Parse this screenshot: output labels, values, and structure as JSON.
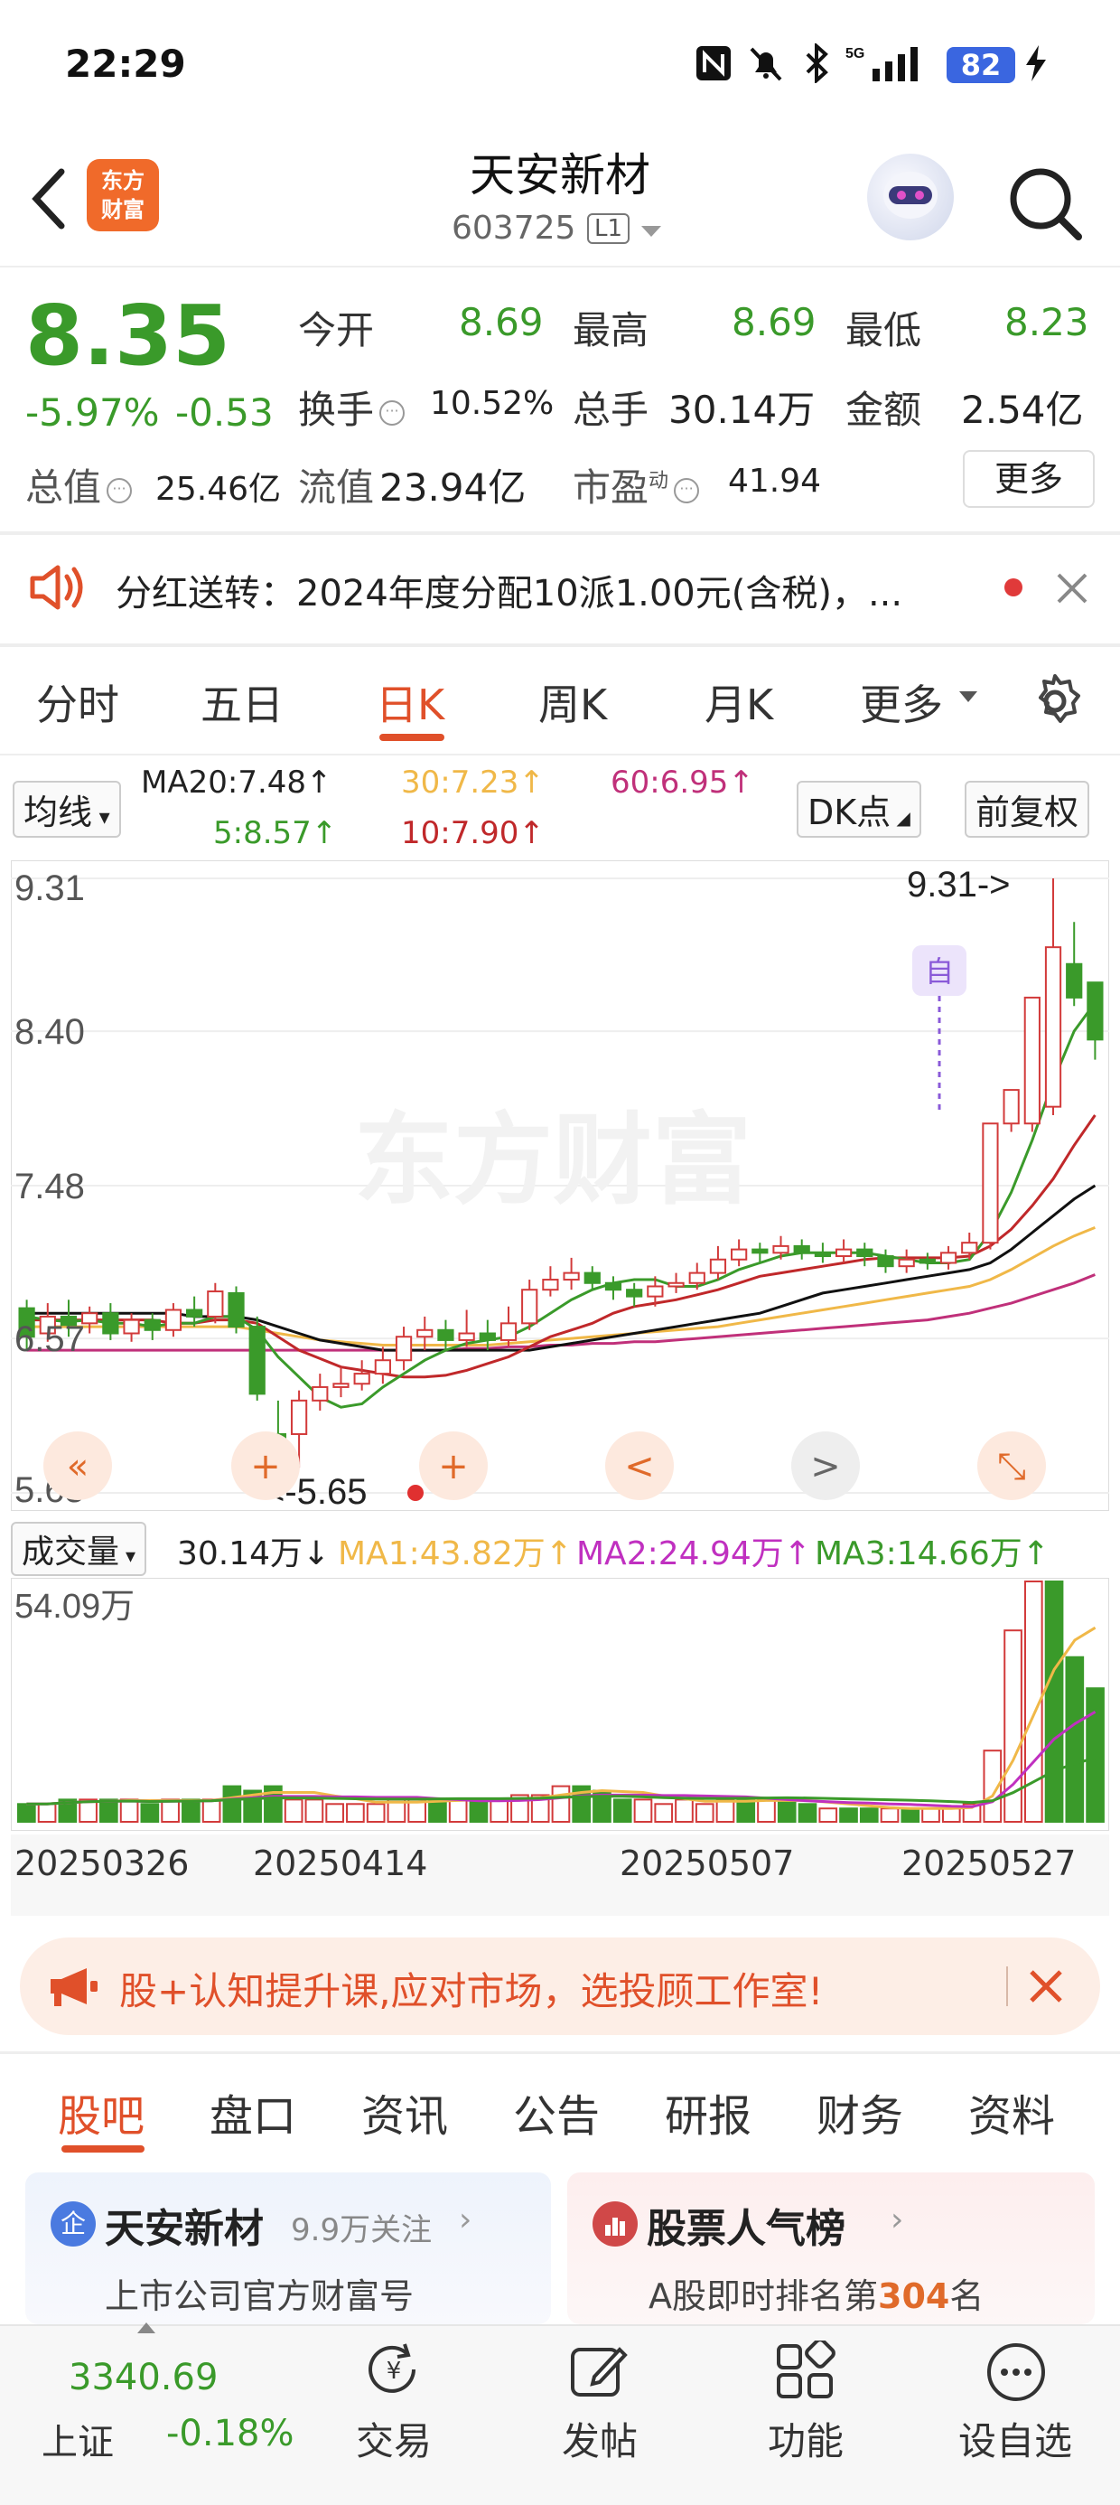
{
  "status_bar": {
    "time": "22:29",
    "battery": "82"
  },
  "header": {
    "logo_text_1": "东方",
    "logo_text_2": "财富",
    "stock_name": "天安新材",
    "stock_code": "603725",
    "level": "L1"
  },
  "quote": {
    "price": "8.35",
    "change_pct": "-5.97%",
    "change": "-0.53",
    "open_label": "今开",
    "open": "8.69",
    "high_label": "最高",
    "high": "8.69",
    "low_label": "最低",
    "low": "8.23",
    "turnover_label": "换手",
    "turnover": "10.52%",
    "volume_label": "总手",
    "volume": "30.14万",
    "amount_label": "金额",
    "amount": "2.54亿",
    "mktcap_label": "总值",
    "mktcap": "25.46亿",
    "float_label": "流值",
    "float_cap": "23.94亿",
    "pe_label": "市盈",
    "pe_sup": "动",
    "pe": "41.94",
    "more_label": "更多"
  },
  "notice": {
    "text": "分红送转：2024年度分配10派1.00元(含税)，..."
  },
  "kline_tabs": [
    "分时",
    "五日",
    "日K",
    "周K",
    "月K",
    "更多"
  ],
  "ma_row": {
    "selector": "均线",
    "ma20": "MA20:7.48↑",
    "ma30": "30:7.23↑",
    "ma60": "60:6.95↑",
    "ma5": "5:8.57↑",
    "ma10": "10:7.90↑",
    "dk_label": "DK点",
    "adj_label": "前复权"
  },
  "chart_data": {
    "type": "candlestick",
    "y_ticks": [
      "9.31",
      "8.40",
      "7.48",
      "6.57",
      "5.65"
    ],
    "ylim": [
      5.65,
      9.31
    ],
    "high_marker": "9.31->",
    "low_marker": "<-5.65",
    "self_marker": "自",
    "watermark": "东方财富",
    "candles": [
      {
        "o": 6.75,
        "c": 6.58,
        "h": 6.8,
        "l": 6.5
      },
      {
        "o": 6.6,
        "c": 6.7,
        "h": 6.78,
        "l": 6.55
      },
      {
        "o": 6.7,
        "c": 6.65,
        "h": 6.8,
        "l": 6.58
      },
      {
        "o": 6.66,
        "c": 6.72,
        "h": 6.76,
        "l": 6.6
      },
      {
        "o": 6.72,
        "c": 6.6,
        "h": 6.78,
        "l": 6.56
      },
      {
        "o": 6.6,
        "c": 6.68,
        "h": 6.72,
        "l": 6.55
      },
      {
        "o": 6.68,
        "c": 6.62,
        "h": 6.72,
        "l": 6.56
      },
      {
        "o": 6.62,
        "c": 6.74,
        "h": 6.78,
        "l": 6.58
      },
      {
        "o": 6.74,
        "c": 6.7,
        "h": 6.82,
        "l": 6.64
      },
      {
        "o": 6.7,
        "c": 6.85,
        "h": 6.9,
        "l": 6.66
      },
      {
        "o": 6.84,
        "c": 6.64,
        "h": 6.88,
        "l": 6.6
      },
      {
        "o": 6.64,
        "c": 6.24,
        "h": 6.7,
        "l": 6.2
      },
      {
        "o": 6.0,
        "c": 5.95,
        "h": 6.2,
        "l": 5.65
      },
      {
        "o": 6.0,
        "c": 6.2,
        "h": 6.26,
        "l": 5.8
      },
      {
        "o": 6.2,
        "c": 6.28,
        "h": 6.36,
        "l": 6.14
      },
      {
        "o": 6.28,
        "c": 6.3,
        "h": 6.4,
        "l": 6.22
      },
      {
        "o": 6.3,
        "c": 6.36,
        "h": 6.44,
        "l": 6.26
      },
      {
        "o": 6.36,
        "c": 6.44,
        "h": 6.52,
        "l": 6.3
      },
      {
        "o": 6.44,
        "c": 6.58,
        "h": 6.64,
        "l": 6.38
      },
      {
        "o": 6.58,
        "c": 6.62,
        "h": 6.7,
        "l": 6.5
      },
      {
        "o": 6.62,
        "c": 6.56,
        "h": 6.68,
        "l": 6.5
      },
      {
        "o": 6.56,
        "c": 6.6,
        "h": 6.74,
        "l": 6.52
      },
      {
        "o": 6.6,
        "c": 6.56,
        "h": 6.68,
        "l": 6.5
      },
      {
        "o": 6.56,
        "c": 6.66,
        "h": 6.76,
        "l": 6.52
      },
      {
        "o": 6.66,
        "c": 6.86,
        "h": 6.92,
        "l": 6.62
      },
      {
        "o": 6.86,
        "c": 6.92,
        "h": 7.0,
        "l": 6.82
      },
      {
        "o": 6.92,
        "c": 6.96,
        "h": 7.05,
        "l": 6.86
      },
      {
        "o": 6.96,
        "c": 6.9,
        "h": 7.0,
        "l": 6.86
      },
      {
        "o": 6.9,
        "c": 6.86,
        "h": 6.94,
        "l": 6.8
      },
      {
        "o": 6.86,
        "c": 6.82,
        "h": 6.9,
        "l": 6.76
      },
      {
        "o": 6.82,
        "c": 6.88,
        "h": 6.94,
        "l": 6.76
      },
      {
        "o": 6.88,
        "c": 6.9,
        "h": 6.96,
        "l": 6.84
      },
      {
        "o": 6.9,
        "c": 6.96,
        "h": 7.02,
        "l": 6.86
      },
      {
        "o": 6.96,
        "c": 7.04,
        "h": 7.12,
        "l": 6.92
      },
      {
        "o": 7.04,
        "c": 7.1,
        "h": 7.16,
        "l": 7.0
      },
      {
        "o": 7.1,
        "c": 7.08,
        "h": 7.14,
        "l": 7.02
      },
      {
        "o": 7.08,
        "c": 7.12,
        "h": 7.18,
        "l": 7.04
      },
      {
        "o": 7.12,
        "c": 7.08,
        "h": 7.16,
        "l": 7.04
      },
      {
        "o": 7.08,
        "c": 7.06,
        "h": 7.14,
        "l": 7.02
      },
      {
        "o": 7.06,
        "c": 7.1,
        "h": 7.16,
        "l": 7.02
      },
      {
        "o": 7.1,
        "c": 7.06,
        "h": 7.14,
        "l": 7.0
      },
      {
        "o": 7.06,
        "c": 7.0,
        "h": 7.1,
        "l": 6.96
      },
      {
        "o": 7.0,
        "c": 7.04,
        "h": 7.1,
        "l": 6.96
      },
      {
        "o": 7.04,
        "c": 7.02,
        "h": 7.08,
        "l": 6.98
      },
      {
        "o": 7.02,
        "c": 7.08,
        "h": 7.12,
        "l": 6.98
      },
      {
        "o": 7.08,
        "c": 7.14,
        "h": 7.2,
        "l": 7.04
      },
      {
        "o": 7.14,
        "c": 7.85,
        "h": 7.85,
        "l": 7.1
      },
      {
        "o": 7.85,
        "c": 8.05,
        "h": 8.05,
        "l": 7.8
      },
      {
        "o": 7.85,
        "c": 8.6,
        "h": 8.6,
        "l": 7.8
      },
      {
        "o": 7.95,
        "c": 8.9,
        "h": 9.31,
        "l": 7.9
      },
      {
        "o": 8.8,
        "c": 8.6,
        "h": 9.05,
        "l": 8.55
      },
      {
        "o": 8.69,
        "c": 8.35,
        "h": 8.69,
        "l": 8.23
      }
    ],
    "ma5": [
      6.7,
      6.68,
      6.67,
      6.68,
      6.66,
      6.66,
      6.64,
      6.66,
      6.66,
      6.7,
      6.7,
      6.62,
      6.46,
      6.34,
      6.22,
      6.16,
      6.18,
      6.28,
      6.36,
      6.44,
      6.5,
      6.54,
      6.56,
      6.58,
      6.64,
      6.72,
      6.8,
      6.86,
      6.9,
      6.92,
      6.92,
      6.88,
      6.88,
      6.92,
      6.98,
      7.02,
      7.06,
      7.08,
      7.08,
      7.08,
      7.08,
      7.06,
      7.04,
      7.02,
      7.02,
      7.04,
      7.2,
      7.44,
      7.75,
      8.1,
      8.4,
      8.57
    ],
    "ma10": [
      6.68,
      6.68,
      6.68,
      6.68,
      6.68,
      6.68,
      6.68,
      6.66,
      6.66,
      6.68,
      6.68,
      6.66,
      6.58,
      6.5,
      6.45,
      6.4,
      6.38,
      6.36,
      6.34,
      6.34,
      6.35,
      6.38,
      6.42,
      6.46,
      6.52,
      6.58,
      6.62,
      6.66,
      6.72,
      6.76,
      6.78,
      6.8,
      6.83,
      6.86,
      6.9,
      6.94,
      6.96,
      6.98,
      7.0,
      7.02,
      7.04,
      7.05,
      7.05,
      7.05,
      7.05,
      7.06,
      7.12,
      7.22,
      7.36,
      7.52,
      7.72,
      7.9
    ],
    "ma20": [
      6.72,
      6.72,
      6.72,
      6.72,
      6.72,
      6.72,
      6.72,
      6.72,
      6.7,
      6.7,
      6.7,
      6.68,
      6.64,
      6.6,
      6.56,
      6.54,
      6.52,
      6.5,
      6.5,
      6.5,
      6.5,
      6.5,
      6.5,
      6.5,
      6.5,
      6.52,
      6.54,
      6.56,
      6.58,
      6.6,
      6.62,
      6.64,
      6.66,
      6.68,
      6.7,
      6.72,
      6.76,
      6.8,
      6.84,
      6.86,
      6.88,
      6.9,
      6.92,
      6.94,
      6.96,
      6.98,
      7.02,
      7.1,
      7.2,
      7.3,
      7.4,
      7.48
    ],
    "ma30": [
      6.64,
      6.64,
      6.64,
      6.64,
      6.64,
      6.64,
      6.64,
      6.64,
      6.64,
      6.64,
      6.64,
      6.62,
      6.6,
      6.58,
      6.56,
      6.55,
      6.54,
      6.53,
      6.53,
      6.53,
      6.53,
      6.53,
      6.53,
      6.54,
      6.55,
      6.56,
      6.57,
      6.58,
      6.59,
      6.6,
      6.61,
      6.62,
      6.63,
      6.64,
      6.66,
      6.68,
      6.7,
      6.72,
      6.74,
      6.76,
      6.78,
      6.8,
      6.82,
      6.84,
      6.86,
      6.88,
      6.92,
      6.98,
      7.05,
      7.12,
      7.18,
      7.23
    ],
    "ma60": [
      6.5,
      6.5,
      6.5,
      6.5,
      6.5,
      6.5,
      6.5,
      6.5,
      6.5,
      6.5,
      6.5,
      6.5,
      6.5,
      6.5,
      6.5,
      6.5,
      6.5,
      6.5,
      6.5,
      6.5,
      6.5,
      6.51,
      6.51,
      6.52,
      6.52,
      6.53,
      6.53,
      6.54,
      6.54,
      6.55,
      6.55,
      6.56,
      6.57,
      6.58,
      6.59,
      6.6,
      6.61,
      6.62,
      6.63,
      6.64,
      6.65,
      6.66,
      6.67,
      6.68,
      6.7,
      6.72,
      6.75,
      6.78,
      6.82,
      6.86,
      6.9,
      6.95
    ],
    "colors": {
      "up": "#d23a3a",
      "down": "#3a9a2a",
      "ma5": "#3a9a2a",
      "ma10": "#c0282a",
      "ma20": "#111111",
      "ma30": "#f0b848",
      "ma60": "#c0307a"
    }
  },
  "chart_controls": [
    "«",
    "+",
    "+",
    "<",
    ">",
    "⤡"
  ],
  "volume": {
    "selector": "成交量",
    "current": "30.14万↓",
    "ma1": "MA1:43.82万↑",
    "ma2": "MA2:24.94万↑",
    "ma3": "MA3:14.66万↑",
    "max_label": "54.09万",
    "bars": [
      4,
      4,
      5,
      5,
      5,
      5,
      4,
      5,
      5,
      5,
      8,
      7,
      8,
      5,
      5,
      4,
      4,
      4,
      5,
      5,
      5,
      5,
      5,
      5,
      6,
      6,
      8,
      8,
      7,
      5,
      5,
      4,
      5,
      4,
      5,
      5,
      5,
      5,
      4,
      3,
      3,
      3,
      3,
      3,
      3,
      3,
      4,
      16,
      43,
      54,
      54,
      37,
      30
    ],
    "dates": [
      "20250326",
      "20250414",
      "20250507",
      "20250527"
    ]
  },
  "ad": {
    "text": "股+认知提升课,应对市场，选投顾工作室!"
  },
  "bottom_tabs": [
    "股吧",
    "盘口",
    "资讯",
    "公告",
    "研报",
    "财务",
    "资料"
  ],
  "cards": {
    "left_title": "天安新材",
    "left_follow": "9.9万关注",
    "left_sub": "上市公司官方财富号",
    "right_title": "股票人气榜",
    "right_sub_pre": "A股即时排名第",
    "right_rank": "304",
    "right_sub_post": "名"
  },
  "bottom_nav": {
    "index_value": "3340.69",
    "index_name": "上证",
    "index_change": "-0.18%",
    "items": [
      "交易",
      "发帖",
      "功能",
      "设自选"
    ]
  }
}
